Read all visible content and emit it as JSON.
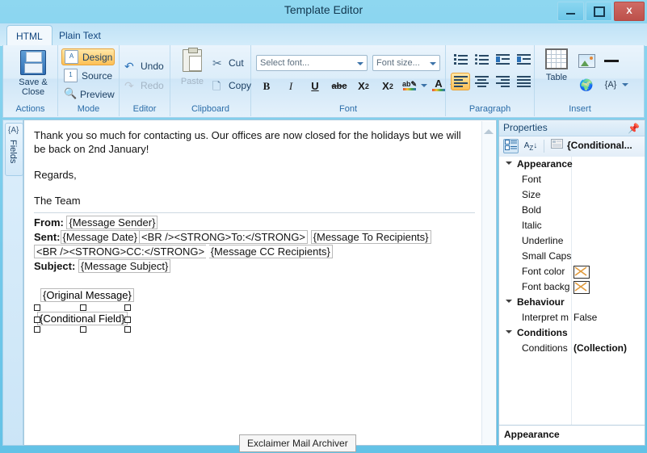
{
  "window": {
    "title": "Template Editor",
    "minimize_label": "minimize",
    "maximize_label": "maximize",
    "close_label": "X"
  },
  "tabs": [
    {
      "label": "HTML",
      "active": true
    },
    {
      "label": "Plain Text",
      "active": false
    }
  ],
  "ribbon": {
    "groups": [
      {
        "name": "Actions",
        "label": "Actions",
        "items": [
          {
            "label": "Save &\nClose",
            "icon": "floppy-disk-icon"
          }
        ]
      },
      {
        "name": "Mode",
        "label": "Mode",
        "items": [
          {
            "label": "Design",
            "icon": "design-icon",
            "selected": true
          },
          {
            "label": "Source",
            "icon": "source-icon",
            "selected": false
          },
          {
            "label": "Preview",
            "icon": "magnifier-icon",
            "selected": false
          }
        ]
      },
      {
        "name": "Editor",
        "label": "Editor",
        "items": [
          {
            "label": "Undo",
            "icon": "undo-icon",
            "enabled": true
          },
          {
            "label": "Redo",
            "icon": "redo-icon",
            "enabled": false
          }
        ]
      },
      {
        "name": "Clipboard",
        "label": "Clipboard",
        "items": [
          {
            "label": "Paste",
            "icon": "paste-icon",
            "enabled": false
          },
          {
            "label": "Cut",
            "icon": "scissors-icon",
            "enabled": true
          },
          {
            "label": "Copy",
            "icon": "copy-icon",
            "enabled": true
          }
        ]
      },
      {
        "name": "Font",
        "label": "Font",
        "font_name_placeholder": "Select font...",
        "font_size_placeholder": "Font size...",
        "buttons": [
          {
            "label": "B",
            "name": "bold-button"
          },
          {
            "label": "I",
            "name": "italic-button"
          },
          {
            "label": "U",
            "name": "underline-button"
          },
          {
            "label": "abc",
            "name": "strikethrough-button"
          },
          {
            "label": "X2",
            "name": "subscript-button"
          },
          {
            "label": "X2",
            "name": "superscript-button"
          },
          {
            "label": "ab",
            "name": "highlight-color-button"
          },
          {
            "label": "A",
            "name": "font-color-button"
          }
        ]
      },
      {
        "name": "Paragraph",
        "label": "Paragraph",
        "buttons": [
          {
            "name": "numbered-list-button"
          },
          {
            "name": "bulleted-list-button"
          },
          {
            "name": "decrease-indent-button"
          },
          {
            "name": "increase-indent-button"
          },
          {
            "name": "align-left-button",
            "selected": true
          },
          {
            "name": "align-center-button"
          },
          {
            "name": "align-right-button"
          },
          {
            "name": "align-justify-button"
          }
        ]
      },
      {
        "name": "Insert",
        "label": "Insert",
        "items": [
          {
            "label": "Table",
            "icon": "table-icon"
          },
          {
            "label": "",
            "icon": "image-icon"
          },
          {
            "label": "",
            "icon": "horizontal-line-icon"
          },
          {
            "label": "",
            "icon": "hyperlink-icon"
          },
          {
            "label": "",
            "icon": "insert-field-icon"
          }
        ]
      }
    ]
  },
  "left_rail": {
    "fields_tab_label": "Fields",
    "fields_tab_icon": "{A}"
  },
  "editor": {
    "paragraphs": [
      "Thank you so much for contacting us. Our offices are now closed for the holidays but we will be back on 2nd January!",
      "Regards,",
      "The Team"
    ],
    "header_block": {
      "from_label": "From:",
      "from_value": "{Message Sender}",
      "sent_label": "Sent:",
      "sent_value": "{Message Date}",
      "sent_raw_1": "<BR /><STRONG>To:</STRONG>",
      "to_value": "{Message To Recipients}",
      "sent_raw_2": "<BR /><STRONG>CC:</STRONG>",
      "cc_value": "{Message CC Recipients}",
      "subject_label": "Subject:",
      "subject_value": "{Message Subject}"
    },
    "original_message_field": "{Original Message}",
    "conditional_field": "{Conditional Field}",
    "footer_box": "Exclaimer Mail Archiver"
  },
  "properties": {
    "title": "Properties",
    "pin_icon": "pin-icon",
    "toolbar": {
      "categorized_label": "categorized-view",
      "alphabetical_label": "A-Z",
      "property_pages_label": "property-pages"
    },
    "selected_object": "{Conditional...",
    "rows": [
      {
        "type": "category",
        "name": "Appearance",
        "value": ""
      },
      {
        "type": "property",
        "name": "Font",
        "value": ""
      },
      {
        "type": "property",
        "name": "Size",
        "value": ""
      },
      {
        "type": "property",
        "name": "Bold",
        "value": ""
      },
      {
        "type": "property",
        "name": "Italic",
        "value": ""
      },
      {
        "type": "property",
        "name": "Underline",
        "value": ""
      },
      {
        "type": "property",
        "name": "Small Caps",
        "value": ""
      },
      {
        "type": "property",
        "name": "Font color",
        "value": "",
        "swatch": "none"
      },
      {
        "type": "property",
        "name": "Font backg",
        "value": "",
        "swatch": "none"
      },
      {
        "type": "category",
        "name": "Behaviour",
        "value": ""
      },
      {
        "type": "property",
        "name": "Interpret m",
        "value": "False"
      },
      {
        "type": "category",
        "name": "Conditions",
        "value": ""
      },
      {
        "type": "property",
        "name": "Conditions",
        "value": "(Collection)",
        "bold": true
      }
    ],
    "footer": "Appearance"
  },
  "colors": {
    "window_chrome": "#74c9ea",
    "close_button": "#bc504a",
    "selection_highlight": "#fdc055",
    "accent_text": "#11457e"
  }
}
